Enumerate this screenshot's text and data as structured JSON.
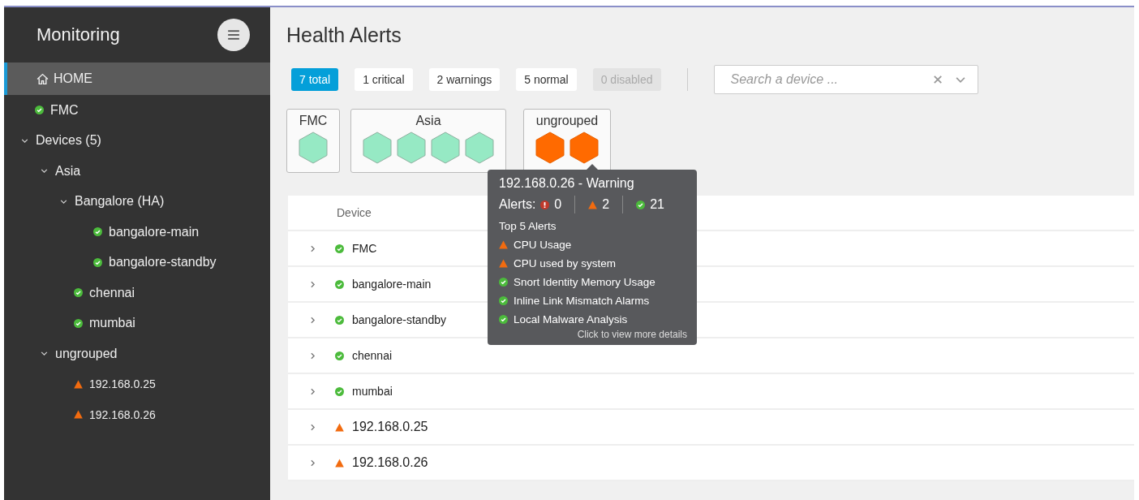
{
  "sidebar": {
    "title": "Monitoring",
    "home": {
      "label": "HOME",
      "selected": true
    },
    "tree": [
      {
        "label": "FMC",
        "kind": "ok"
      },
      {
        "label": "Devices (5)",
        "kind": "group",
        "expanded": true,
        "children": [
          {
            "label": "Asia",
            "kind": "group",
            "expanded": true,
            "children": [
              {
                "label": "Bangalore (HA)",
                "kind": "group",
                "expanded": true,
                "children": [
                  {
                    "label": "bangalore-main",
                    "kind": "ok"
                  },
                  {
                    "label": "bangalore-standby",
                    "kind": "ok"
                  }
                ]
              },
              {
                "label": "chennai",
                "kind": "ok"
              },
              {
                "label": "mumbai",
                "kind": "ok"
              }
            ]
          },
          {
            "label": "ungrouped",
            "kind": "group",
            "expanded": true,
            "children": [
              {
                "label": "192.168.0.25",
                "kind": "warning"
              },
              {
                "label": "192.168.0.26",
                "kind": "warning"
              }
            ]
          }
        ]
      }
    ]
  },
  "page_title": "Health Alerts",
  "filters": [
    {
      "label": "7 total",
      "selected": true,
      "disabled": false
    },
    {
      "label": "1 critical",
      "selected": false,
      "disabled": false
    },
    {
      "label": "2 warnings",
      "selected": false,
      "disabled": false
    },
    {
      "label": "5 normal",
      "selected": false,
      "disabled": false
    },
    {
      "label": "0 disabled",
      "selected": false,
      "disabled": true
    }
  ],
  "search": {
    "placeholder": "Search a device ..."
  },
  "groups": [
    {
      "label": "FMC",
      "devices": [
        {
          "kind": "ok"
        }
      ]
    },
    {
      "label": "Asia",
      "devices": [
        {
          "kind": "ok"
        },
        {
          "kind": "ok"
        },
        {
          "kind": "ok"
        },
        {
          "kind": "ok"
        }
      ]
    },
    {
      "label": "ungrouped",
      "devices": [
        {
          "kind": "warning"
        },
        {
          "kind": "warning"
        }
      ]
    }
  ],
  "table": {
    "columns": [
      "Device"
    ],
    "rows": [
      {
        "device": "FMC",
        "kind": "ok"
      },
      {
        "device": "bangalore-main",
        "kind": "ok"
      },
      {
        "device": "bangalore-standby",
        "kind": "ok"
      },
      {
        "device": "chennai",
        "kind": "ok"
      },
      {
        "device": "mumbai",
        "kind": "ok"
      },
      {
        "device": "192.168.0.25",
        "kind": "warning"
      },
      {
        "device": "192.168.0.26",
        "kind": "warning"
      }
    ]
  },
  "tooltip": {
    "title": "192.168.0.26 - Warning",
    "alerts_label": "Alerts:",
    "counts": [
      {
        "kind": "critical",
        "count": "0"
      },
      {
        "kind": "warning",
        "count": "2"
      },
      {
        "kind": "ok",
        "count": "21"
      }
    ],
    "heading": "Top 5 Alerts",
    "items": [
      {
        "label": "CPU Usage",
        "kind": "warning"
      },
      {
        "label": "CPU used by system",
        "kind": "warning"
      },
      {
        "label": "Snort Identity Memory Usage",
        "kind": "ok"
      },
      {
        "label": "Inline Link Mismatch Alarms",
        "kind": "ok"
      },
      {
        "label": "Local Malware Analysis",
        "kind": "ok"
      }
    ],
    "footer": "Click to view more details"
  }
}
